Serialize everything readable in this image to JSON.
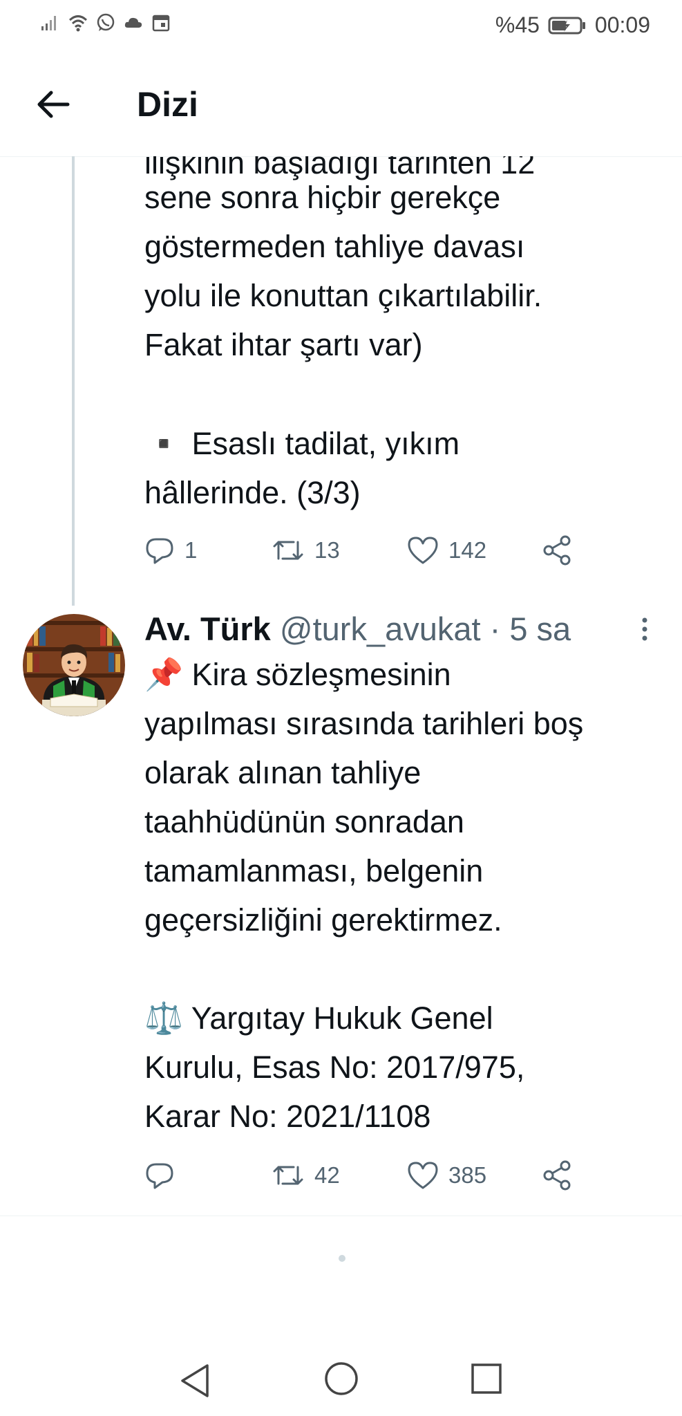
{
  "status_bar": {
    "battery_percent": "%45",
    "time": "00:09",
    "icons": [
      "signal-icon",
      "wifi-icon",
      "whatsapp-icon",
      "cloud-icon",
      "calendar-icon",
      "battery-icon"
    ]
  },
  "header": {
    "title": "Dizi"
  },
  "prev_tweet": {
    "cut_line": "ilişkinin başladığı tarihten 12",
    "text": "sene sonra hiçbir gerekçe\ngöstermeden tahliye davası\nyolu ile konuttan çıkartılabilir.\nFakat ihtar şartı var)",
    "bullet_text": "▪️ Esaslı tadilat, yıkım\nhâllerinde. (3/3)",
    "reply_count": "1",
    "retweet_count": "13",
    "like_count": "142"
  },
  "tweet": {
    "author_name": "Av. Türk",
    "handle": "@turk_avukat",
    "time": " · 5 sa",
    "text": "📌 Kira sözleşmesinin\nyapılması sırasında tarihleri boş\nolarak alınan tahliye\ntaahhüdünün sonradan\ntamamlanması, belgenin\ngeçersizliğini gerektirmez.\n\n⚖️ Yargıtay Hukuk Genel\nKurulu, Esas No: 2017/975,\nKarar No: 2021/1108",
    "reply_count": "",
    "retweet_count": "42",
    "like_count": "385"
  },
  "colors": {
    "text": "#0f1419",
    "muted": "#536471",
    "thread": "#cfd9de"
  }
}
